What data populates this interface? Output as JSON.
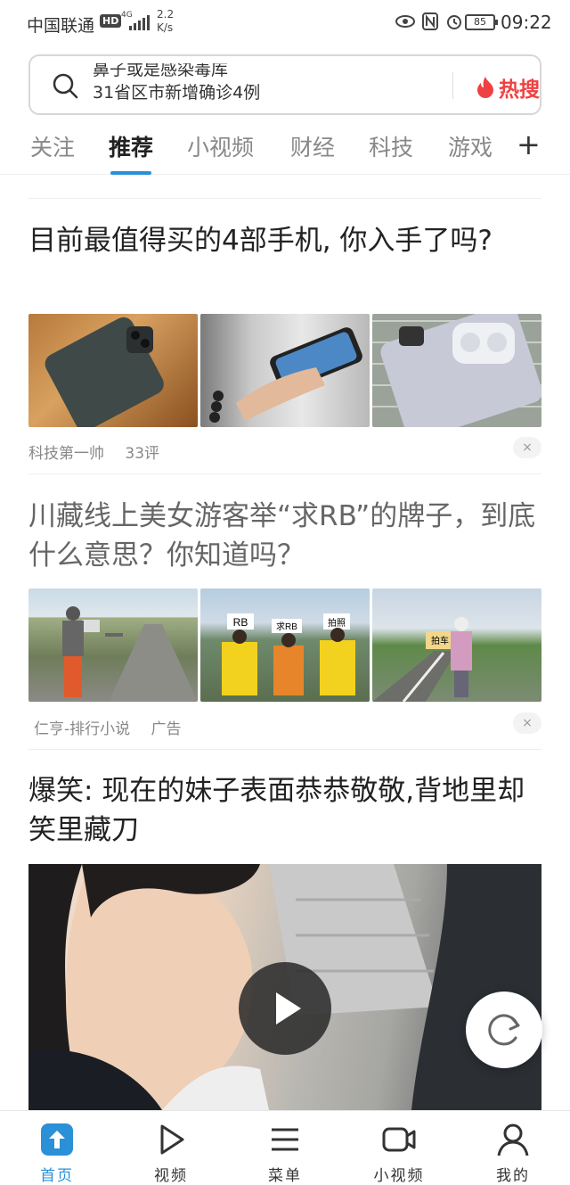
{
  "status_bar": {
    "carrier": "中国联通",
    "hd": "HD",
    "network": "4G",
    "speed_value": "2.2",
    "speed_unit": "K/s",
    "battery": "85",
    "time": "09:22"
  },
  "search": {
    "roll_line_1": "鼻子或是感染毒库",
    "roll_line_2": "31省区市新增确诊4例",
    "hot_label": "热搜"
  },
  "tabs": [
    {
      "label": "关注"
    },
    {
      "label": "推荐"
    },
    {
      "label": "小视频"
    },
    {
      "label": "财经"
    },
    {
      "label": "科技"
    },
    {
      "label": "游戏"
    }
  ],
  "tab_add": "+",
  "feed": [
    {
      "title": "目前最值得买的4部手机, 你入手了吗?",
      "source": "科技第一帅",
      "comments": "33评",
      "close": "×"
    },
    {
      "title": "川藏线上美女游客举“求RB”的牌子，到底什么意思？你知道吗？",
      "source": "仁亨-排行小说",
      "tag": "广告",
      "close": "×",
      "sign_1": "RB",
      "sign_2": "求RB",
      "sign_3": "拍照",
      "sign_4": "拍车"
    },
    {
      "title": "爆笑: 现在的妹子表面恭恭敬敬,背地里却笑里藏刀"
    }
  ],
  "bottom_nav": [
    {
      "label": "首页",
      "icon": "home-arrow-icon"
    },
    {
      "label": "视频",
      "icon": "play-icon"
    },
    {
      "label": "菜单",
      "icon": "menu-icon"
    },
    {
      "label": "小视频",
      "icon": "video-camera-icon"
    },
    {
      "label": "我的",
      "icon": "user-icon"
    }
  ],
  "colors": {
    "accent": "#2a90d7",
    "hot": "#f04142"
  }
}
